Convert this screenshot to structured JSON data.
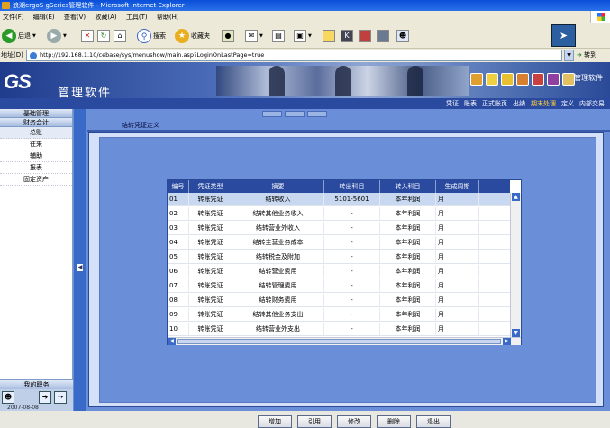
{
  "window": {
    "title": "浪潮ergoS gSeries管理软件 - Microsoft Internet Explorer"
  },
  "menu": [
    "文件(F)",
    "编辑(E)",
    "查看(V)",
    "收藏(A)",
    "工具(T)",
    "帮助(H)"
  ],
  "toolbar": {
    "back": "后退",
    "search": "搜索",
    "favorites": "收藏夹"
  },
  "address": {
    "label": "地址(D)",
    "url": "http://192.168.1.10/cebase/sys/menushow/main.asp?LoginOnLastPage=true",
    "go": "转到"
  },
  "app": {
    "logo": "GS",
    "name": "管理软件",
    "right_name": "管理软件"
  },
  "nav": {
    "links": [
      "凭证",
      "账表",
      "正式账页",
      "出纳",
      "期末处理",
      "定义",
      "内部交易"
    ],
    "active": 4
  },
  "sidebar": {
    "sections": [
      "基础管理",
      "财务会计"
    ],
    "items": [
      "总账",
      "往来",
      "辅助",
      "报表",
      "固定资产"
    ],
    "footer_title": "我的职务",
    "footer_text": "2007-08-08"
  },
  "page": {
    "title": "结转凭证定义"
  },
  "table": {
    "columns": [
      "编号",
      "凭证类型",
      "摘要",
      "转出科目",
      "转入科目",
      "生成周期"
    ],
    "rows": [
      [
        "01",
        "转账凭证",
        "结转收入",
        "5101-5601",
        "本年利润",
        "月"
      ],
      [
        "02",
        "转账凭证",
        "结转其他业务收入",
        "-",
        "本年利润",
        "月"
      ],
      [
        "03",
        "转账凭证",
        "结转营业外收入",
        "-",
        "本年利润",
        "月"
      ],
      [
        "04",
        "转账凭证",
        "结转主营业务成本",
        "-",
        "本年利润",
        "月"
      ],
      [
        "05",
        "转账凭证",
        "结转税金及附加",
        "-",
        "本年利润",
        "月"
      ],
      [
        "06",
        "转账凭证",
        "结转营业费用",
        "-",
        "本年利润",
        "月"
      ],
      [
        "07",
        "转账凭证",
        "结转管理费用",
        "-",
        "本年利润",
        "月"
      ],
      [
        "08",
        "转账凭证",
        "结转财务费用",
        "-",
        "本年利润",
        "月"
      ],
      [
        "09",
        "转账凭证",
        "结转其他业务支出",
        "-",
        "本年利润",
        "月"
      ],
      [
        "10",
        "转账凭证",
        "结转营业外支出",
        "-",
        "本年利润",
        "月"
      ]
    ],
    "selected_row": 0
  },
  "buttons": {
    "add": "增加",
    "quote": "引用",
    "edit": "修改",
    "delete": "删除",
    "exit": "退出"
  }
}
